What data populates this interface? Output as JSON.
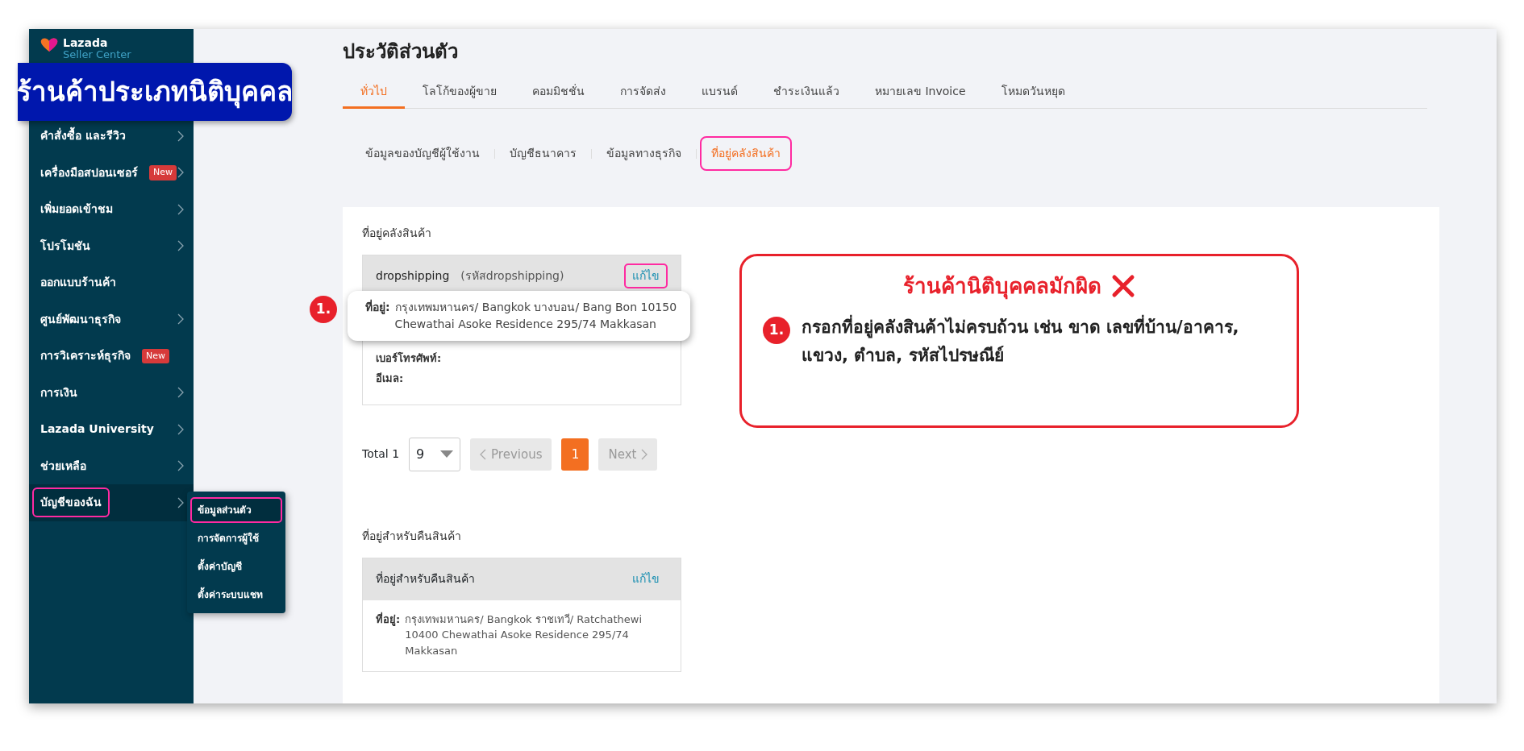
{
  "annotation_banner": "ร้านค้าประเภทนิติบุคคล",
  "sidebar": {
    "logo": {
      "brand": "Lazada",
      "tagline": "Seller Center"
    },
    "items": [
      {
        "label": "คำสั่งซื้อ และรีวิว",
        "arrow": true,
        "selected": false,
        "highlighted": false
      },
      {
        "label": "เครื่องมือสปอนเซอร์",
        "badge": "New",
        "arrow": true,
        "selected": false,
        "highlighted": false
      },
      {
        "label": "เพิ่มยอดเข้าชม",
        "arrow": true,
        "selected": false,
        "highlighted": false
      },
      {
        "label": "โปรโมชัน",
        "arrow": true,
        "selected": false,
        "highlighted": false
      },
      {
        "label": "ออกแบบร้านค้า",
        "arrow": false,
        "selected": false,
        "highlighted": false
      },
      {
        "label": "ศูนย์พัฒนาธุรกิจ",
        "arrow": true,
        "selected": false,
        "highlighted": false
      },
      {
        "label": "การวิเคราะห์ธุรกิจ",
        "badge": "New",
        "arrow": false,
        "selected": false,
        "highlighted": false
      },
      {
        "label": "การเงิน",
        "arrow": true,
        "selected": false,
        "highlighted": false
      },
      {
        "label": "Lazada University",
        "arrow": true,
        "selected": false,
        "highlighted": false
      },
      {
        "label": "ช่วยเหลือ",
        "arrow": true,
        "selected": false,
        "highlighted": false
      },
      {
        "label": "บัญชีของฉัน",
        "arrow": true,
        "selected": true,
        "highlighted": true
      }
    ],
    "submenu": [
      {
        "label": "ข้อมูลส่วนตัว",
        "selected": true,
        "highlighted": true
      },
      {
        "label": "การจัดการผู้ใช้",
        "selected": false,
        "highlighted": false
      },
      {
        "label": "ตั้งค่าบัญชี",
        "selected": false,
        "highlighted": false
      },
      {
        "label": "ตั้งค่าระบบแชท",
        "selected": false,
        "highlighted": false
      }
    ]
  },
  "page_title": "ประวัติส่วนตัว",
  "tabs": [
    {
      "label": "ทั่วไป",
      "selected": true
    },
    {
      "label": "โลโก้ของผู้ขาย",
      "selected": false
    },
    {
      "label": "คอมมิชชั่น",
      "selected": false
    },
    {
      "label": "การจัดส่ง",
      "selected": false
    },
    {
      "label": "แบรนด์",
      "selected": false
    },
    {
      "label": "ชำระเงินแล้ว",
      "selected": false
    },
    {
      "label": "หมายเลข Invoice",
      "selected": false
    },
    {
      "label": "โหมดวันหยุด",
      "selected": false
    }
  ],
  "subtabs": [
    {
      "label": "ข้อมูลของบัญชีผู้ใช้งาน",
      "selected": false,
      "highlighted": false
    },
    {
      "label": "บัญชีธนาคาร",
      "selected": false,
      "highlighted": false
    },
    {
      "label": "ข้อมูลทางธุรกิจ",
      "selected": false,
      "highlighted": false
    },
    {
      "label": "ที่อยู่คลังสินค้า",
      "selected": true,
      "highlighted": true
    }
  ],
  "warehouse": {
    "section_label": "ที่อยู่คลังสินค้า",
    "name": "dropshipping",
    "code": "(รหัสdropshipping)",
    "edit": {
      "label": "แก้ไข",
      "highlighted": true
    },
    "popup": {
      "number": "1.",
      "label": "ที่อยู่:",
      "value": "กรุงเทพมหานคร/ Bangkok บางบอน/ Bang Bon 10150 Chewathai Asoke Residence 295/74 Makkasan"
    },
    "fields": [
      "เบอร์โทรศัพท์:",
      "อีเมล:"
    ]
  },
  "pagination": {
    "total": "Total 1",
    "page_size": "9",
    "previous": {
      "label": "Previous",
      "disabled": true
    },
    "pages": [
      {
        "label": "1",
        "selected": true
      }
    ],
    "next": {
      "label": "Next",
      "disabled": true
    }
  },
  "return_address": {
    "section_label": "ที่อยู่สำหรับคืนสินค้า",
    "title": "ที่อยู่สำหรับคืนสินค้า",
    "edit": {
      "label": "แก้ไข",
      "highlighted": false
    },
    "label": "ที่อยู่:",
    "value": "กรุงเทพมหานคร/ Bangkok ราชเทวี/ Ratchathewi 10400 Chewathai Asoke Residence 295/74 Makkasan"
  },
  "callout": {
    "title": "ร้านค้านิติบุคคลมักผิด",
    "items": [
      {
        "number": "1.",
        "text": "กรอกที่อยู่คลังสินค้า**ไม่ครบถ้วน** เช่น ขาด เลขที่บ้าน/อาคาร, แขวง, ตำบล, รหัสไปรษณีย์"
      }
    ]
  }
}
